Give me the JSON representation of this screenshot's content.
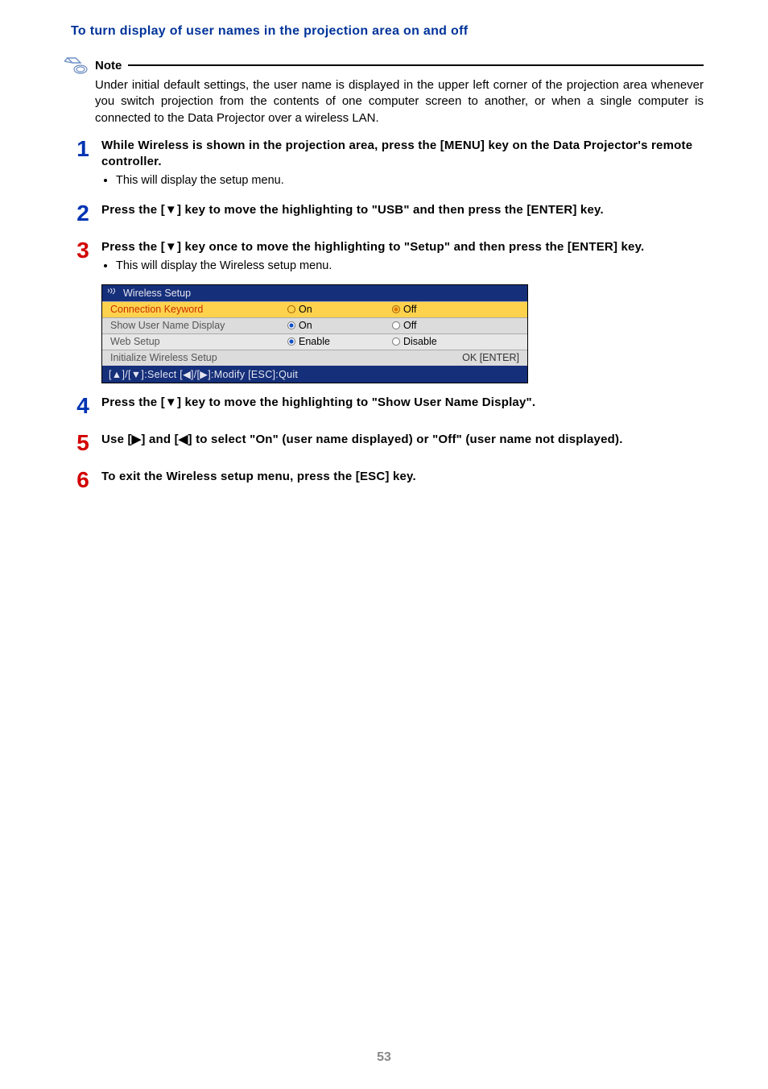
{
  "title": "To turn display of user names in the projection area on and off",
  "note": {
    "label": "Note",
    "body": "Under initial default settings, the user name is displayed in the upper left corner of the projection area whenever you switch projection from the contents of one computer screen to another, or when a single computer is connected to the Data Projector over a wireless LAN."
  },
  "steps": [
    {
      "num": "1",
      "color": "blue",
      "head": "While Wireless is shown in the projection area, press the [MENU] key on the Data Projector's remote controller.",
      "bullets": [
        "This will display the setup menu."
      ]
    },
    {
      "num": "2",
      "color": "blue",
      "head": "Press the [▼] key to move the highlighting to \"USB\" and then press the [ENTER] key."
    },
    {
      "num": "3",
      "color": "red",
      "head": "Press the [▼] key once to move the highlighting to \"Setup\" and then press the [ENTER] key.",
      "bullets": [
        "This will display the Wireless setup menu."
      ]
    },
    {
      "num": "4",
      "color": "blue",
      "head": "Press the [▼] key to move the highlighting to \"Show User Name Display\"."
    },
    {
      "num": "5",
      "color": "red",
      "head": "Use [▶] and [◀] to select \"On\" (user name displayed) or \"Off\" (user name not displayed)."
    },
    {
      "num": "6",
      "color": "red",
      "head": "To exit the Wireless setup menu, press the [ESC] key."
    }
  ],
  "wireless_menu": {
    "title": "Wireless Setup",
    "rows": [
      {
        "label": "Connection Keyword",
        "opt1": "On",
        "opt2": "Off",
        "sel": 2,
        "hl": true
      },
      {
        "label": "Show User Name Display",
        "opt1": "On",
        "opt2": "Off",
        "sel": 1
      },
      {
        "label": "Web Setup",
        "opt1": "Enable",
        "opt2": "Disable",
        "sel": 1
      },
      {
        "label": "Initialize Wireless Setup",
        "right": "OK [ENTER]"
      }
    ],
    "footer": "[▲]/[▼]:Select  [◀]/[▶]:Modify  [ESC]:Quit"
  },
  "page_number": "53"
}
